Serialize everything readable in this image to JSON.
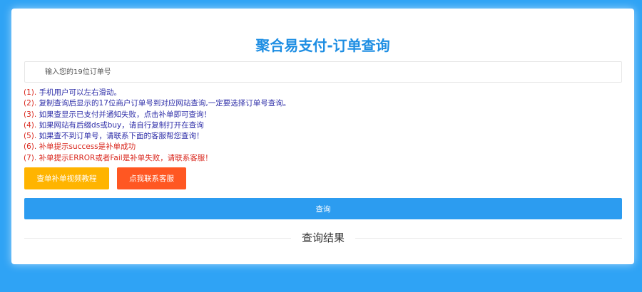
{
  "page": {
    "title": "聚合易支付-订单查询"
  },
  "search": {
    "placeholder": "输入您的19位订单号"
  },
  "notes": [
    {
      "num": "(1).",
      "text": "手机用户可以左右滑动。",
      "color": "blue"
    },
    {
      "num": "(2).",
      "text": "复制查询后显示的17位商户订单号到对应网站查询,一定要选择订单号查询。",
      "color": "blue"
    },
    {
      "num": "(3).",
      "text": "如果查显示已支付并通知失败，点击补单即可查询！",
      "color": "blue"
    },
    {
      "num": "(4).",
      "text": "如果网站有后缀ds或buy，请自行复制打开在查询",
      "color": "blue"
    },
    {
      "num": "(5).",
      "text": "如果查不到订单号，请联系下面的客服帮您查询！",
      "color": "blue"
    },
    {
      "num": "(6).",
      "text": "补单提示success是补单成功",
      "color": "red"
    },
    {
      "num": "(7).",
      "text": "补单提示ERROR或者Fail是补单失败，请联系客服！",
      "color": "red"
    }
  ],
  "buttons": {
    "video_tutorial": "查单补单视频教程",
    "contact_service": "点我联系客服",
    "query": "查询"
  },
  "result": {
    "title": "查询结果"
  },
  "colors": {
    "background": "#2fa3f5",
    "title": "#1e8ee3",
    "note_blue": "#2e2ea8",
    "note_red": "#d9261c",
    "btn_video": "#ffb400",
    "btn_contact": "#ff5722",
    "btn_query": "#2c9cf0"
  }
}
